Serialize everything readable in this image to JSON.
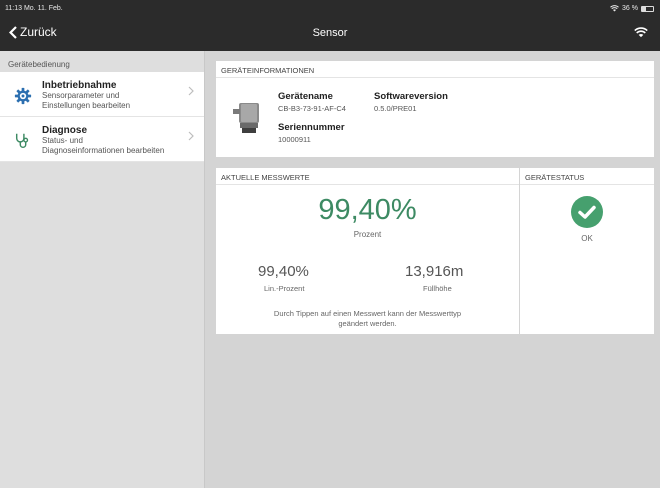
{
  "statusbar": {
    "time": "11:13",
    "date": "Mo. 11. Feb.",
    "battery": "36 %",
    "battery_level": 0.36
  },
  "navbar": {
    "back_label": "Zurück",
    "title": "Sensor"
  },
  "sidebar": {
    "header": "Gerätebedienung",
    "items": [
      {
        "title": "Inbetriebnahme",
        "subtitle1": "Sensorparameter und",
        "subtitle2": "Einstellungen bearbeiten",
        "icon": "gear-icon"
      },
      {
        "title": "Diagnose",
        "subtitle1": "Status- und",
        "subtitle2": "Diagnoseinformationen bearbeiten",
        "icon": "stethoscope-icon"
      }
    ]
  },
  "geraeteinfo": {
    "header": "GERÄTEINFORMATIONEN",
    "name_label": "Gerätename",
    "name_value": "CB-B3-73-91-AF-C4",
    "software_label": "Softwareversion",
    "software_value": "0.5.0/PRE01",
    "serial_label": "Seriennummer",
    "serial_value": "10000911"
  },
  "messwerte": {
    "header": "AKTUELLE MESSWERTE",
    "primary_value": "99,40%",
    "primary_unit": "Prozent",
    "secondary": [
      {
        "value": "99,40%",
        "unit": "Lin.-Prozent"
      },
      {
        "value": "13,916m",
        "unit": "Füllhöhe"
      }
    ],
    "hint_line1": "Durch Tippen auf einen Messwert kann der Messwerttyp",
    "hint_line2": "geändert werden."
  },
  "geraetestatus": {
    "header": "GERÄTESTATUS",
    "status": "OK",
    "color": "#46a06e"
  }
}
